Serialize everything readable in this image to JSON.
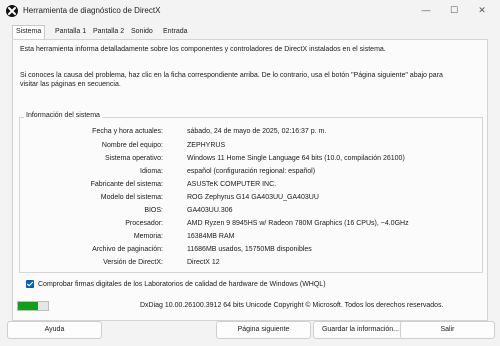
{
  "window": {
    "title": "Herramienta de diagnóstico de DirectX",
    "minimize": "—",
    "maximize": "☐",
    "close": "✕"
  },
  "tabs": [
    {
      "label": "Sistema",
      "active": true
    },
    {
      "label": "Pantalla 1"
    },
    {
      "label": "Pantalla 2"
    },
    {
      "label": "Sonido"
    },
    {
      "label": "Entrada"
    }
  ],
  "intro": "Esta herramienta informa detalladamente sobre los componentes y controladores de DirectX instalados en el sistema.",
  "hint": "Si conoces la causa del problema, haz clic en la ficha correspondiente arriba. De lo contrario, usa el botón \"Página siguiente\" abajo para visitar las páginas en secuencia.",
  "system_info": {
    "title": "Información del sistema",
    "rows": [
      {
        "label": "Fecha y hora actuales:",
        "value": "sábado, 24 de mayo de 2025, 02:16:37 p. m."
      },
      {
        "label": "Nombre del equipo:",
        "value": "ZEPHYRUS"
      },
      {
        "label": "Sistema operativo:",
        "value": "Windows 11 Home Single Language 64 bits (10.0, compilación 26100)"
      },
      {
        "label": "Idioma:",
        "value": "español (configuración regional: español)"
      },
      {
        "label": "Fabricante del sistema:",
        "value": "ASUSTeK COMPUTER INC."
      },
      {
        "label": "Modelo del sistema:",
        "value": "ROG Zephyrus G14 GA403UU_GA403UU"
      },
      {
        "label": "BIOS:",
        "value": "GA403UU.306"
      },
      {
        "label": "Procesador:",
        "value": "AMD Ryzen 9 8945HS w/ Radeon 780M Graphics (16 CPUs), ~4.0GHz"
      },
      {
        "label": "Memoria:",
        "value": "16384MB RAM"
      },
      {
        "label": "Archivo de paginación:",
        "value": "11686MB usados, 15750MB disponibles"
      },
      {
        "label": "Versión de DirectX:",
        "value": "DirectX 12"
      }
    ]
  },
  "whql_checkbox": {
    "label": "Comprobar firmas digitales de los Laboratorios de calidad de hardware de Windows (WHQL)",
    "checked": true
  },
  "progress": {
    "fraction": 0.65,
    "color": "#10a018"
  },
  "footer_info": "DxDiag 10.00.26100.3912 64 bits Unicode  Copyright © Microsoft. Todos los derechos reservados.",
  "buttons": {
    "help": "Ayuda",
    "next": "Página siguiente",
    "save": "Guardar la información...",
    "exit": "Salir"
  },
  "colors": {
    "accent": "#005fb8"
  }
}
